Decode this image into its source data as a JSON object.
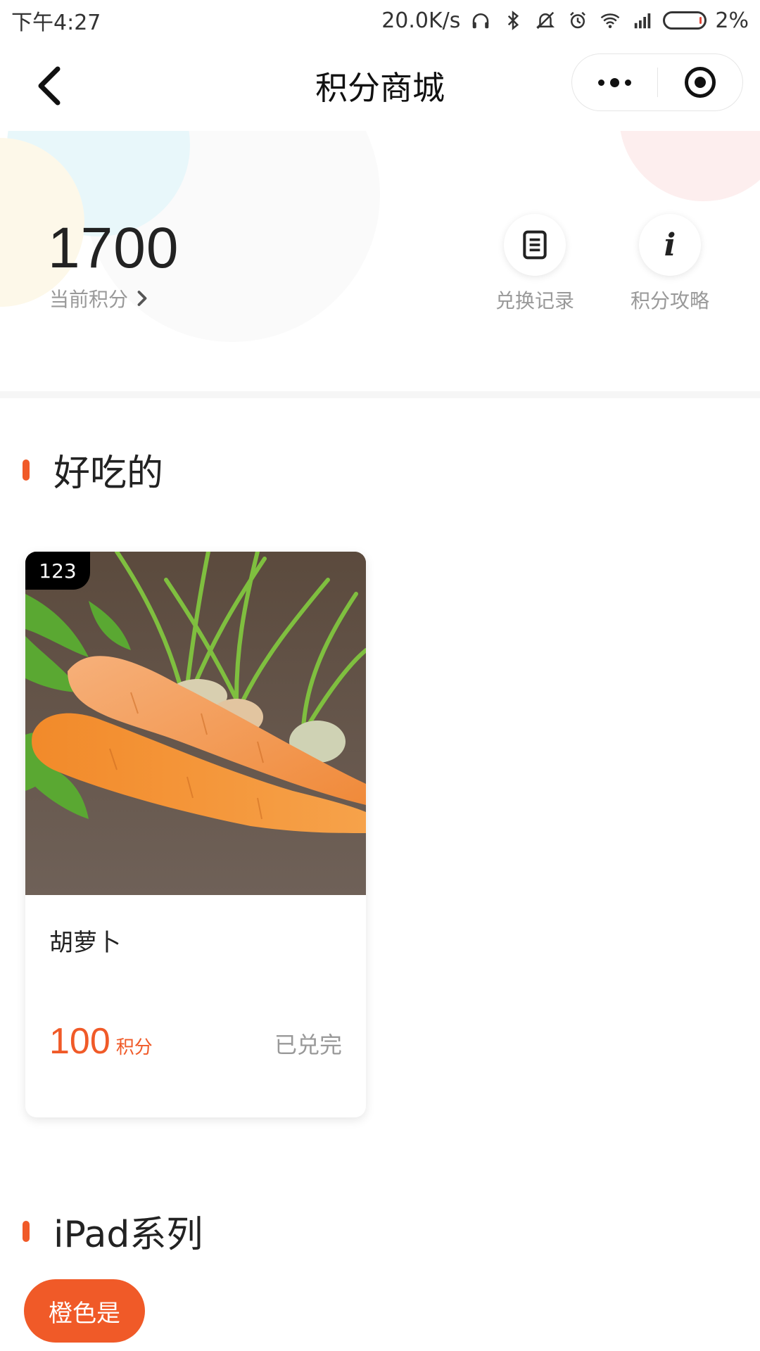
{
  "status_bar": {
    "time": "下午4:27",
    "net_speed": "20.0K/s",
    "battery": "2%",
    "icons": [
      "headphones-icon",
      "bluetooth-icon",
      "mute-bell-icon",
      "alarm-icon",
      "wifi-icon",
      "signal-icon",
      "battery-icon"
    ]
  },
  "nav": {
    "title": "积分商城"
  },
  "points": {
    "value": "1700",
    "label": "当前积分"
  },
  "actions": {
    "redeem_records": "兑换记录",
    "points_guide": "积分攻略"
  },
  "sections": [
    {
      "title": "好吃的",
      "products": [
        {
          "badge": "123",
          "name": "胡萝卜",
          "price": "100",
          "price_unit": "积分",
          "status": "已兑完",
          "image": "carrots-photo"
        }
      ]
    },
    {
      "title": "iPad系列",
      "tags": [
        "橙色是"
      ]
    }
  ],
  "colors": {
    "accent": "#f05a28",
    "text": "#222222",
    "muted": "#999999"
  }
}
